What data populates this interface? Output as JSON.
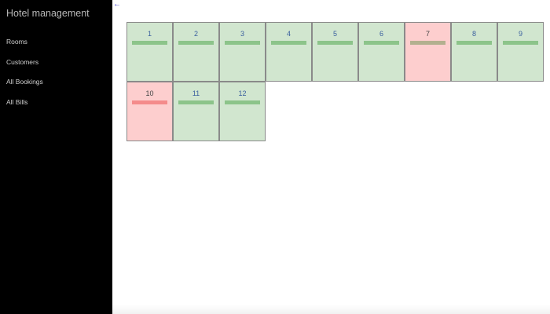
{
  "app": {
    "title": "Hotel management"
  },
  "nav": {
    "items": [
      {
        "label": "Rooms",
        "name": "nav-item-rooms"
      },
      {
        "label": "Customers",
        "name": "nav-item-customers"
      },
      {
        "label": "All Bookings",
        "name": "nav-item-all-bookings"
      },
      {
        "label": "All Bills",
        "name": "nav-item-all-bills"
      }
    ]
  },
  "back_link": {
    "icon": "arrow-left-icon",
    "glyph": "←"
  },
  "colors": {
    "sidebar_bg": "#000000",
    "available_bg": "#d1e6cf",
    "available_bar": "#8cc48a",
    "available_text": "#3a5f9e",
    "occupied_bg": "#fdcece",
    "occupied_bar_a": "#b3b08f",
    "occupied_bar_b": "#f48b8b",
    "occupied_text": "#444444"
  },
  "rooms": [
    {
      "number": "1",
      "status": "available"
    },
    {
      "number": "2",
      "status": "available"
    },
    {
      "number": "3",
      "status": "available"
    },
    {
      "number": "4",
      "status": "available"
    },
    {
      "number": "5",
      "status": "available"
    },
    {
      "number": "6",
      "status": "available"
    },
    {
      "number": "7",
      "status": "occupied",
      "bar_color": "#b3b08f"
    },
    {
      "number": "8",
      "status": "available"
    },
    {
      "number": "9",
      "status": "available"
    },
    {
      "number": "10",
      "status": "occupied",
      "bar_color": "#f48b8b"
    },
    {
      "number": "11",
      "status": "available"
    },
    {
      "number": "12",
      "status": "available"
    }
  ]
}
